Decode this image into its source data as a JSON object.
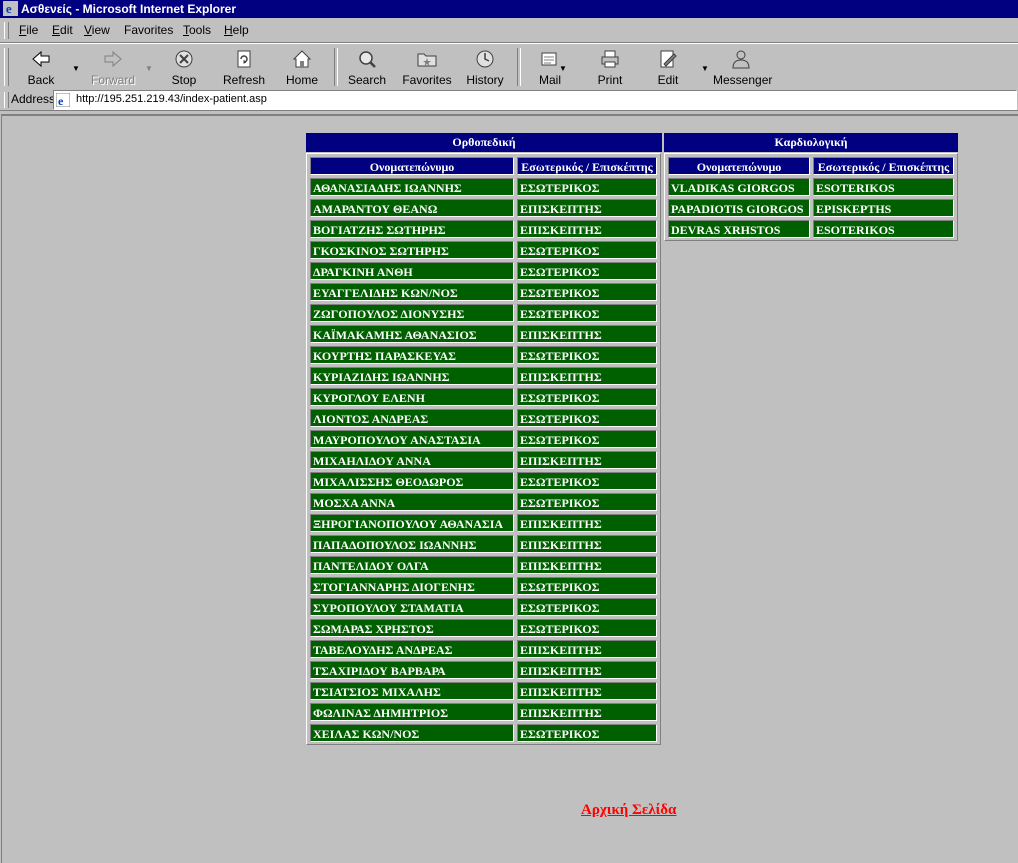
{
  "window": {
    "title": "Ασθενείς - Microsoft Internet Explorer"
  },
  "menu": [
    {
      "label": "File",
      "key": "F"
    },
    {
      "label": "Edit",
      "key": "E"
    },
    {
      "label": "View",
      "key": "V"
    },
    {
      "label": "Favorites",
      "key": "a"
    },
    {
      "label": "Tools",
      "key": "T"
    },
    {
      "label": "Help",
      "key": "H"
    }
  ],
  "toolbar": {
    "back": "Back",
    "forward": "Forward",
    "stop": "Stop",
    "refresh": "Refresh",
    "home": "Home",
    "search": "Search",
    "favorites": "Favorites",
    "history": "History",
    "mail": "Mail",
    "print": "Print",
    "edit": "Edit",
    "messenger": "Messenger"
  },
  "address": {
    "label": "Address",
    "url": "http://195.251.219.43/index-patient.asp"
  },
  "departments": [
    {
      "name": "Ορθοπεδική",
      "col_name": "Ονοματεπώνυμο",
      "col_type": "Εσωτερικός / Επισκέπτης",
      "rows": [
        [
          "ΑΘΑΝΑΣΙΑΔΗΣ ΙΩΑΝΝΗΣ",
          "ΕΣΩΤΕΡΙΚΟΣ"
        ],
        [
          "ΑΜΑΡΑΝΤΟΥ ΘΕΑΝΩ",
          "ΕΠΙΣΚΕΠΤΗΣ"
        ],
        [
          "ΒΟΓΙΑΤΖΗΣ ΣΩΤΗΡΗΣ",
          "ΕΠΙΣΚΕΠΤΗΣ"
        ],
        [
          "ΓΚΟΣΚΙΝΟΣ ΣΩΤΗΡΗΣ",
          "ΕΣΩΤΕΡΙΚΟΣ"
        ],
        [
          "ΔΡΑΓΚΙΝΗ ΑΝΘΗ",
          "ΕΣΩΤΕΡΙΚΟΣ"
        ],
        [
          "ΕΥΑΓΓΕΛΙΔΗΣ ΚΩΝ/ΝΟΣ",
          "ΕΣΩΤΕΡΙΚΟΣ"
        ],
        [
          "ΖΩΓΟΠΟΥΛΟΣ ΔΙΟΝΥΣΗΣ",
          "ΕΣΩΤΕΡΙΚΟΣ"
        ],
        [
          "ΚΑΪΜΑΚΑΜΗΣ ΑΘΑΝΑΣΙΟΣ",
          "ΕΠΙΣΚΕΠΤΗΣ"
        ],
        [
          "ΚΟΥΡΤΗΣ ΠΑΡΑΣΚΕΥΑΣ",
          "ΕΣΩΤΕΡΙΚΟΣ"
        ],
        [
          "ΚΥΡΙΑΖΙΔΗΣ ΙΩΑΝΝΗΣ",
          "ΕΠΙΣΚΕΠΤΗΣ"
        ],
        [
          "ΚΥΡΟΓΛΟΥ ΕΛΕΝΗ",
          "ΕΣΩΤΕΡΙΚΟΣ"
        ],
        [
          "ΛΙΟΝΤΟΣ ΑΝΔΡΕΑΣ",
          "ΕΣΩΤΕΡΙΚΟΣ"
        ],
        [
          "ΜΑΥΡΟΠΟΥΛΟΥ ΑΝΑΣΤΑΣΙΑ",
          "ΕΣΩΤΕΡΙΚΟΣ"
        ],
        [
          "ΜΙΧΑΗΛΙΔΟΥ ΑΝΝΑ",
          "ΕΠΙΣΚΕΠΤΗΣ"
        ],
        [
          "ΜΙΧΑΛΙΣΣΗΣ ΘΕΟΔΩΡΟΣ",
          "ΕΣΩΤΕΡΙΚΟΣ"
        ],
        [
          "ΜΟΣΧΑ ΑΝΝΑ",
          "ΕΣΩΤΕΡΙΚΟΣ"
        ],
        [
          "ΞΗΡΟΓΙΑΝΟΠΟΥΛΟΥ ΑΘΑΝΑΣΙΑ",
          "ΕΠΙΣΚΕΠΤΗΣ"
        ],
        [
          "ΠΑΠΑΔΟΠΟΥΛΟΣ ΙΩΑΝΝΗΣ",
          "ΕΠΙΣΚΕΠΤΗΣ"
        ],
        [
          "ΠΑΝΤΕΛΙΔΟΥ ΟΛΓΑ",
          "ΕΠΙΣΚΕΠΤΗΣ"
        ],
        [
          "ΣΤΟΓΙΑΝΝΑΡΗΣ ΔΙΟΓΕΝΗΣ",
          "ΕΣΩΤΕΡΙΚΟΣ"
        ],
        [
          "ΣΥΡΟΠΟΥΛΟΥ ΣΤΑΜΑΤΙΑ",
          "ΕΣΩΤΕΡΙΚΟΣ"
        ],
        [
          "ΣΩΜΑΡΑΣ ΧΡΗΣΤΟΣ",
          "ΕΣΩΤΕΡΙΚΟΣ"
        ],
        [
          "ΤΑΒΕΛΟΥΔΗΣ ΑΝΔΡΕΑΣ",
          "ΕΠΙΣΚΕΠΤΗΣ"
        ],
        [
          "ΤΣΑΧΙΡΙΔΟΥ ΒΑΡΒΑΡΑ",
          "ΕΠΙΣΚΕΠΤΗΣ"
        ],
        [
          "ΤΣΙΑΤΣΙΟΣ ΜΙΧΑΛΗΣ",
          "ΕΠΙΣΚΕΠΤΗΣ"
        ],
        [
          "ΦΩΛΙΝΑΣ ΔΗΜΗΤΡΙΟΣ",
          "ΕΠΙΣΚΕΠΤΗΣ"
        ],
        [
          "ΧΕΙΛΑΣ ΚΩΝ/ΝΟΣ",
          "ΕΣΩΤΕΡΙΚΟΣ"
        ]
      ]
    },
    {
      "name": "Καρδιολογική",
      "col_name": "Ονοματεπώνυμο",
      "col_type": "Εσωτερικός / Επισκέπτης",
      "rows": [
        [
          "VLADIKAS GIORGOS",
          "ESOTERIKOS"
        ],
        [
          "PAPADIOTIS GIORGOS",
          "EPISKEPTHS"
        ],
        [
          "DEVRAS XRHSTOS",
          "ESOTERIKOS"
        ]
      ]
    }
  ],
  "home_link": "Αρχική Σελίδα"
}
